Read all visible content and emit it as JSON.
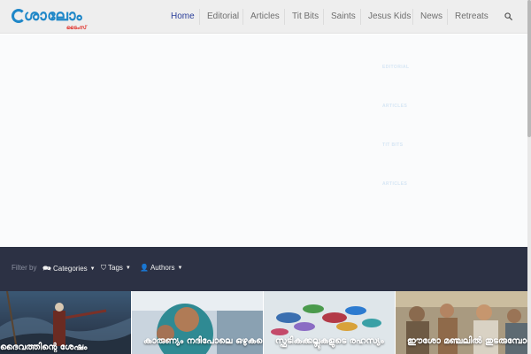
{
  "site": {
    "logo_text": "ശാലോം",
    "logo_sub": "ടൈംസ്"
  },
  "nav": {
    "items": [
      {
        "label": "Home",
        "active": true
      },
      {
        "label": "Editorial",
        "active": false
      },
      {
        "label": "Articles",
        "active": false
      },
      {
        "label": "Tit Bits",
        "active": false
      },
      {
        "label": "Saints",
        "active": false
      },
      {
        "label": "Jesus Kids",
        "active": false
      },
      {
        "label": "News",
        "active": false
      },
      {
        "label": "Retreats",
        "active": false
      }
    ],
    "search_icon": "search-icon"
  },
  "hero": {
    "labels": [
      "EDITORIAL",
      "ARTICLES",
      "TIT BITS",
      "ARTICLES"
    ]
  },
  "filter": {
    "label": "Filter by",
    "categories": "Categories",
    "tags": "Tags",
    "authors": "Authors"
  },
  "cards": [
    {
      "title": "ദൈവത്തിന്റെ ശേഷം"
    },
    {
      "title": "കാരുണ്യം നദിപോലെ ഒഴുകട്ടെ"
    },
    {
      "title": "സ്ഫടികക്കല്ലുകളുടെ രഹസ്യം"
    },
    {
      "title": "ഈശോ മഞ്ചലിൽ തുടരുമ്പോൾ"
    }
  ],
  "colors": {
    "accent": "#2b3f9a",
    "logo": "#1f87c8",
    "filter_bar": "#2c3144"
  }
}
